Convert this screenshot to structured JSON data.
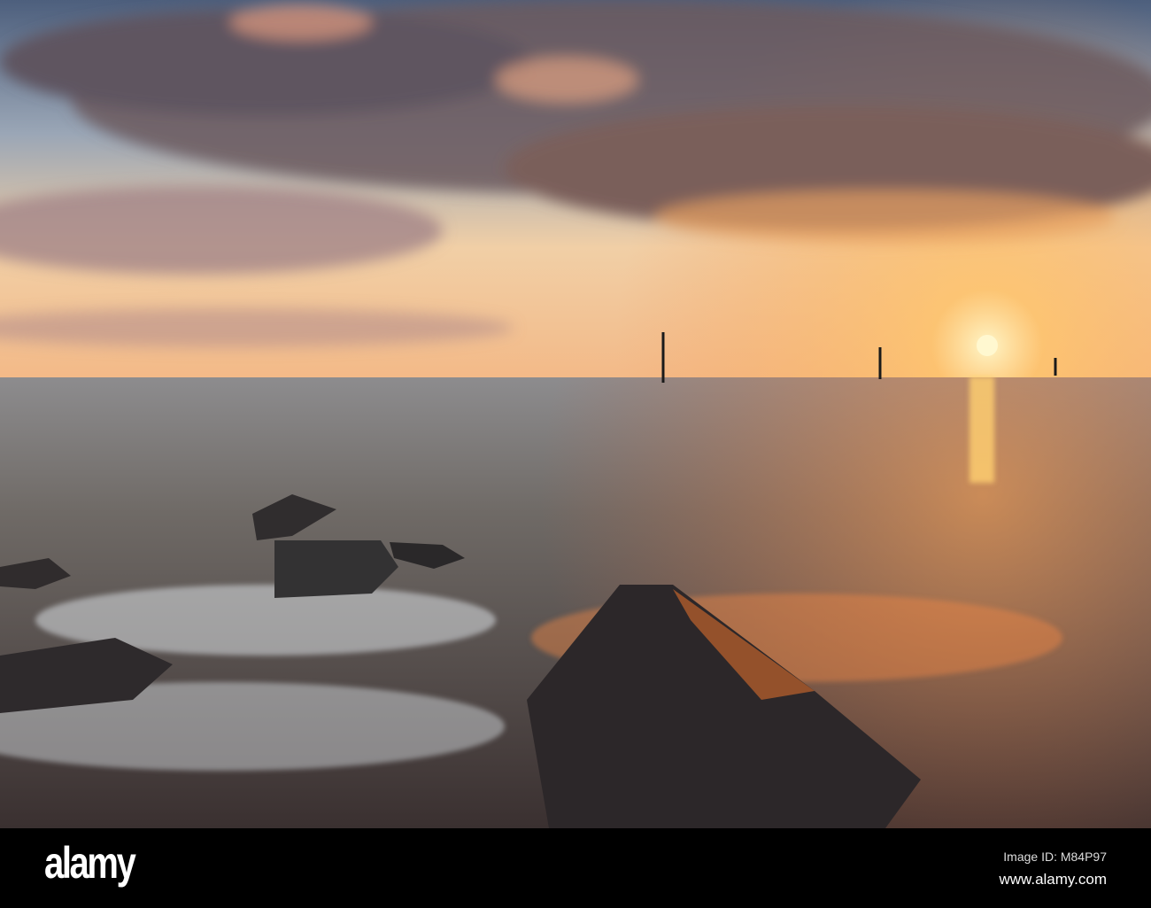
{
  "photo": {
    "subject": "sunset-seascape",
    "colors": {
      "sky_top": "#5a6f8c",
      "sky_glow": "#f6c48a",
      "sea": "#6c6660",
      "sun": "#fff2b0",
      "rock": "#2a2628"
    }
  },
  "footer": {
    "logo": "alamy",
    "image_id": "Image ID: M84P97",
    "website": "www.alamy.com"
  }
}
